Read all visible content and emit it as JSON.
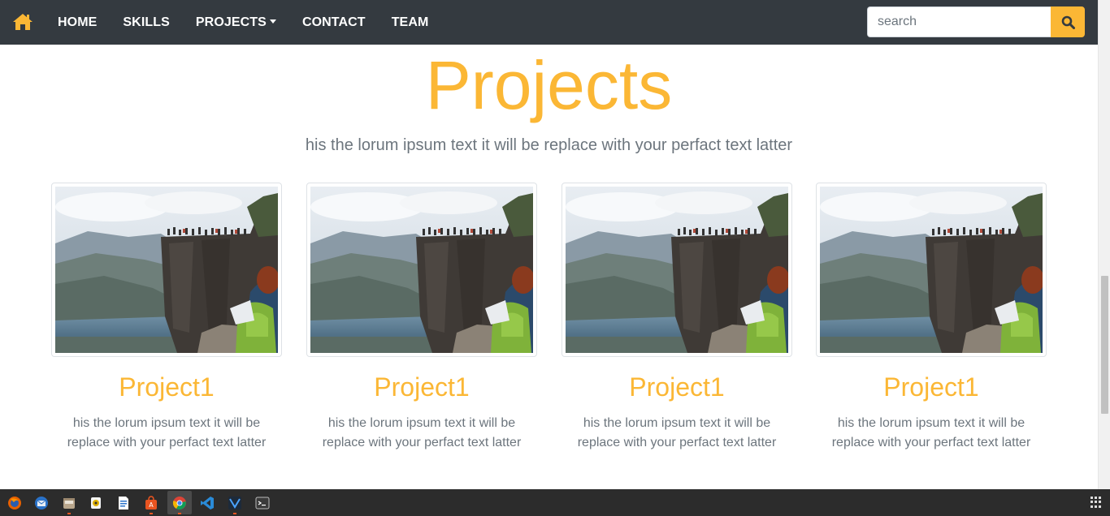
{
  "navbar": {
    "home_icon": "home-icon",
    "links": [
      {
        "label": "HOME"
      },
      {
        "label": "SKILLS"
      },
      {
        "label": "PROJECTS",
        "has_dropdown": true
      },
      {
        "label": "CONTACT"
      },
      {
        "label": "TEAM"
      }
    ],
    "search": {
      "placeholder": "search",
      "value": ""
    },
    "search_icon": "search-icon"
  },
  "main": {
    "title": "Projects",
    "subtitle": "his the lorum ipsum text it will be replace with your perfact text latter",
    "cards": [
      {
        "title": "Project1",
        "text": "his the lorum ipsum text it will be replace with your perfact text latter",
        "image": "cliff-photo"
      },
      {
        "title": "Project1",
        "text": "his the lorum ipsum text it will be replace with your perfact text latter",
        "image": "cliff-photo"
      },
      {
        "title": "Project1",
        "text": "his the lorum ipsum text it will be replace with your perfact text latter",
        "image": "cliff-photo"
      },
      {
        "title": "Project1",
        "text": "his the lorum ipsum text it will be replace with your perfact text latter",
        "image": "cliff-photo"
      }
    ]
  },
  "colors": {
    "navbar_bg": "#343a40",
    "accent": "#fbb735",
    "muted_text": "#6c757d",
    "taskbar_bg": "#2c2c2c"
  },
  "taskbar": {
    "apps": [
      "firefox-icon",
      "thunderbird-icon",
      "files-icon",
      "rhythmbox-icon",
      "writer-icon",
      "software-center-icon",
      "chrome-icon",
      "vscode-icon",
      "app-icon",
      "terminal-icon"
    ],
    "show_apps_icon": "show-apps-icon"
  }
}
